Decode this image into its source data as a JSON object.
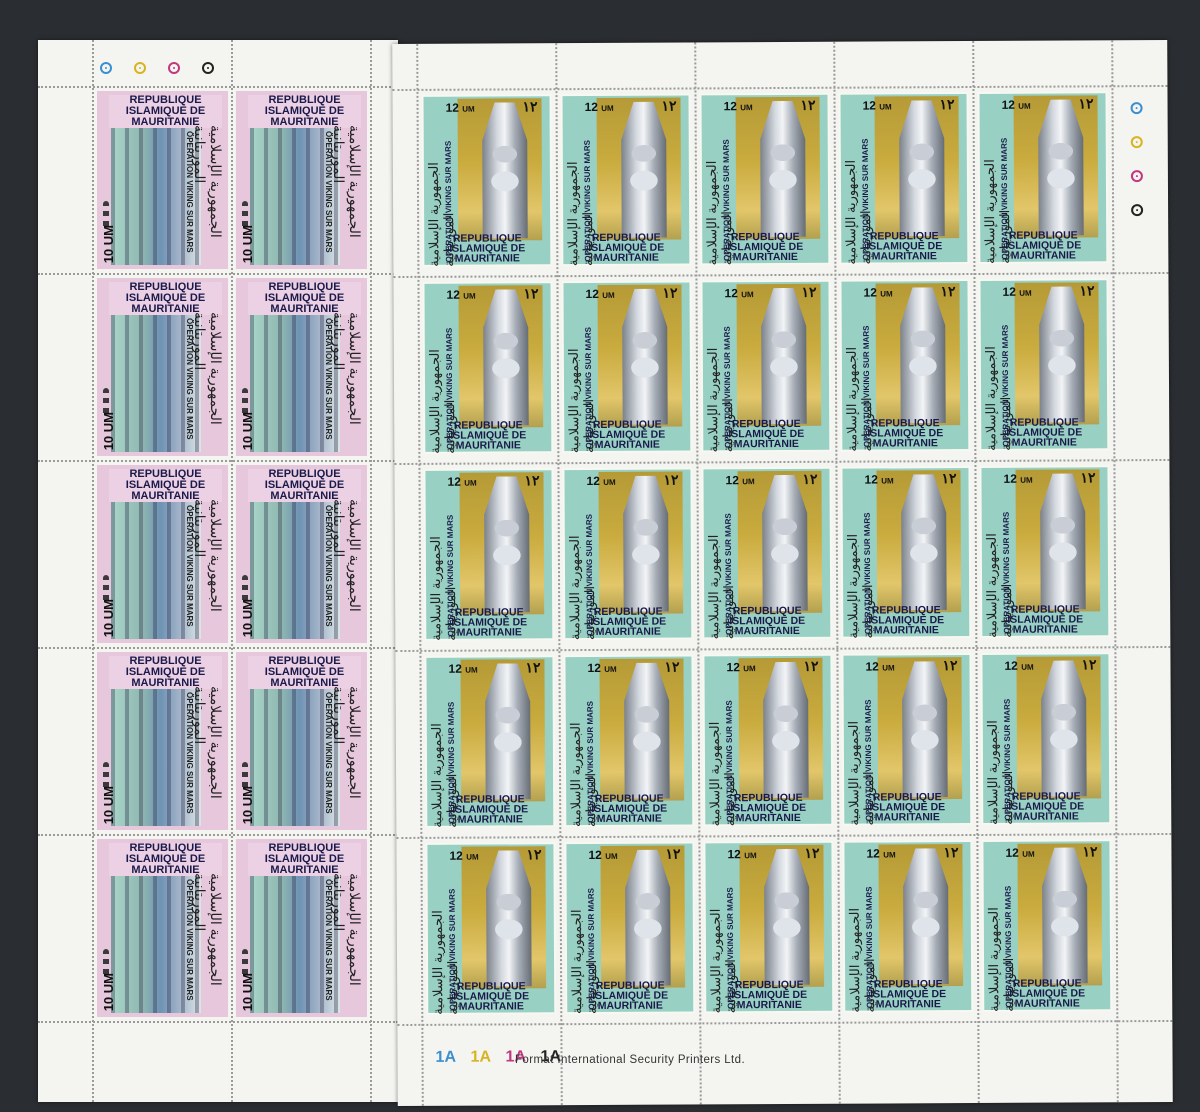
{
  "left_pane": {
    "title": "REPUBLIQUE ISLAMIQUE DE MAURITANIE",
    "subtitle": "OPERATION VIKING SUR MARS",
    "value": "10 UM",
    "arabic_name": "الجمهورية الإسلامية الموريتانية"
  },
  "right_pane": {
    "title": "REPUBLIQUE ISLAMIQUE DE MAURITANIE",
    "subtitle": "OPERATION VIKING SUR MARS",
    "value_number": "12",
    "value_unit": "UM",
    "arabic_value": "١٢",
    "arabic_name": "الجمهورية الإسلامية الموريتانية"
  },
  "control_marks": [
    {
      "text": "1A",
      "color": "#3b8fd0"
    },
    {
      "text": "1A",
      "color": "#d8b420"
    },
    {
      "text": "1A",
      "color": "#c0397f"
    },
    {
      "text": "1A",
      "color": "#222222"
    }
  ],
  "registration_colors": [
    "#3b8fd0",
    "#d8b420",
    "#c0397f",
    "#222222"
  ],
  "printer_imprint": "Format International Security Printers Ltd."
}
